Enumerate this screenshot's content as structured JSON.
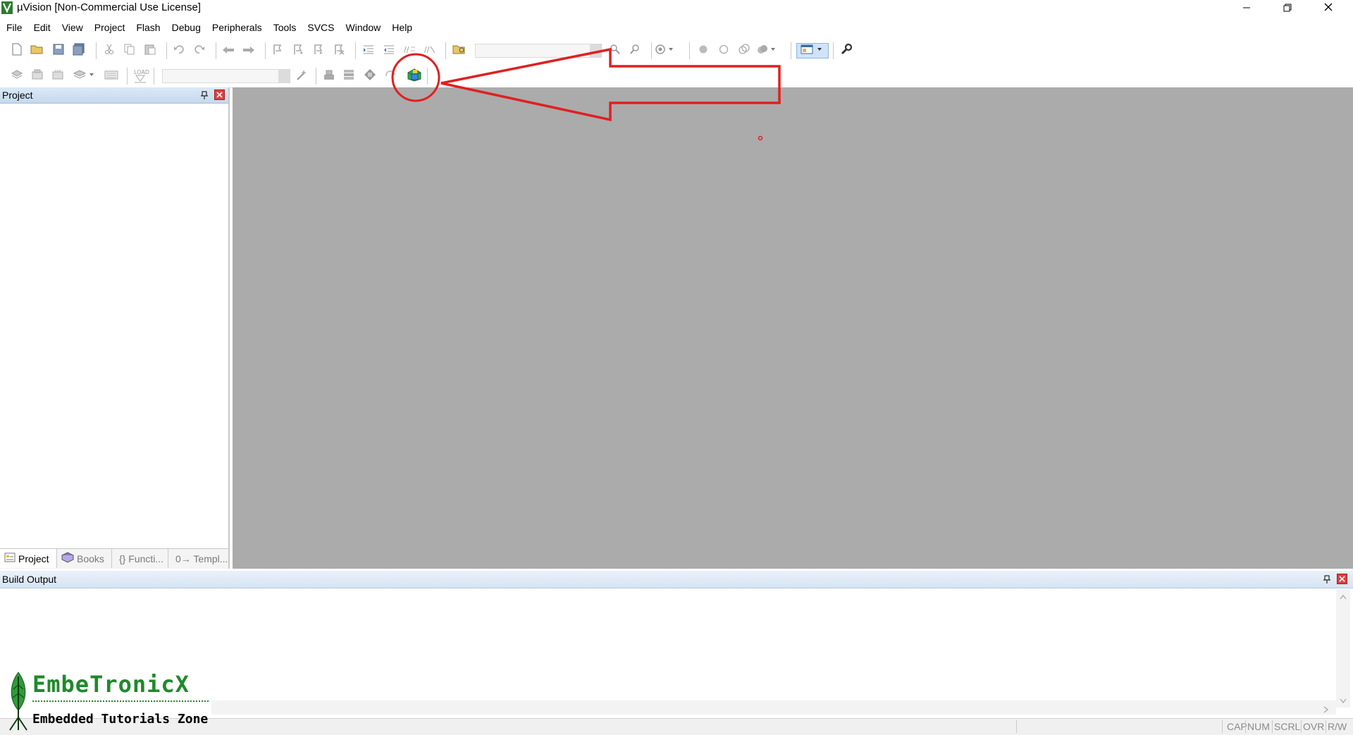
{
  "window": {
    "title": "µVision  [Non-Commercial Use License]",
    "controls": [
      "minimize-icon",
      "restore-icon",
      "close-icon"
    ]
  },
  "menu": {
    "items": [
      "File",
      "Edit",
      "View",
      "Project",
      "Flash",
      "Debug",
      "Peripherals",
      "Tools",
      "SVCS",
      "Window",
      "Help"
    ]
  },
  "toolbar1": {
    "icons": [
      "new-file-icon",
      "open-folder-icon",
      "save-icon",
      "save-all-icon",
      "cut-icon",
      "copy-icon",
      "paste-icon",
      "undo-icon",
      "redo-icon",
      "navigate-back-icon",
      "navigate-forward-icon",
      "bookmark-icon",
      "prev-bookmark-icon",
      "next-bookmark-icon",
      "clear-bookmarks-icon",
      "indent-icon",
      "unindent-icon",
      "comment-icon",
      "uncomment-icon",
      "find-in-files-icon",
      "find-icon",
      "incremental-find-icon",
      "debug-session-icon",
      "breakpoint-icon",
      "disable-breakpoint-icon",
      "disable-all-breakpoints-icon",
      "kill-breakpoints-icon",
      "window-layout-icon",
      "configure-icon"
    ],
    "find_combo_value": ""
  },
  "toolbar2": {
    "icons": [
      "translate-icon",
      "build-icon",
      "rebuild-icon",
      "batch-build-icon",
      "stop-build-icon",
      "download-load-icon",
      "target-options-icon",
      "manage-project-items-icon",
      "select-packs-icon",
      "manage-run-time-environment-icon",
      "pack-installer-icon"
    ],
    "load_label": "LOAD",
    "target_combo_value": ""
  },
  "project_panel": {
    "title": "Project",
    "tabs": [
      {
        "label": "Project",
        "icon": "project-icon",
        "active": true
      },
      {
        "label": "Books",
        "icon": "books-icon",
        "active": false
      },
      {
        "label": "{} Functi...",
        "icon": "functions-icon",
        "active": false
      },
      {
        "label": "0→ Templ...",
        "icon": "templates-icon",
        "active": false
      }
    ]
  },
  "build_output": {
    "title": "Build Output",
    "content": ""
  },
  "status_bar": {
    "indicators": [
      "CAP",
      "NUM",
      "SCRL",
      "OVR",
      "R/W"
    ]
  },
  "watermark": {
    "title": "EmbeTronicX",
    "subtitle": "Embedded Tutorials Zone"
  },
  "annotation": {
    "color": "#e02020",
    "highlighted_icon": "pack-installer-icon"
  },
  "colors": {
    "editor_background": "#ababab",
    "panel_header": "#c6d9ee",
    "close_button": "#e04040"
  }
}
